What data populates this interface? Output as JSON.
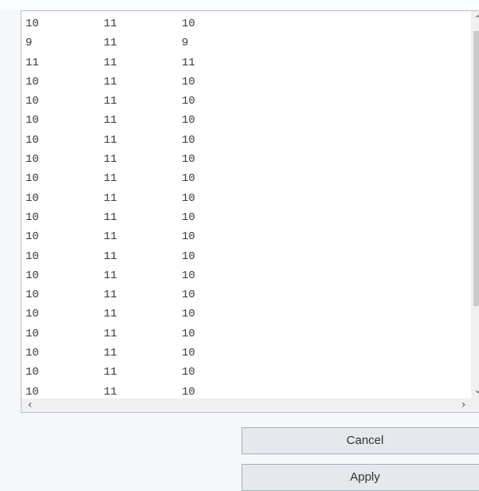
{
  "text_area": {
    "rows": [
      [
        "10",
        "11",
        "10"
      ],
      [
        "9",
        "11",
        "9"
      ],
      [
        "11",
        "11",
        "11"
      ],
      [
        "10",
        "11",
        "10"
      ],
      [
        "10",
        "11",
        "10"
      ],
      [
        "10",
        "11",
        "10"
      ],
      [
        "10",
        "11",
        "10"
      ],
      [
        "10",
        "11",
        "10"
      ],
      [
        "10",
        "11",
        "10"
      ],
      [
        "10",
        "11",
        "10"
      ],
      [
        "10",
        "11",
        "10"
      ],
      [
        "10",
        "11",
        "10"
      ],
      [
        "10",
        "11",
        "10"
      ],
      [
        "10",
        "11",
        "10"
      ],
      [
        "10",
        "11",
        "10"
      ],
      [
        "10",
        "11",
        "10"
      ],
      [
        "10",
        "11",
        "10"
      ],
      [
        "10",
        "11",
        "10"
      ],
      [
        "10",
        "11",
        "10"
      ],
      [
        "10",
        "11",
        "10"
      ]
    ]
  },
  "scrollbars": {
    "up_icon": "chevron-up-icon",
    "down_icon": "chevron-down-icon",
    "left_icon": "chevron-left-icon",
    "right_icon": "chevron-right-icon"
  },
  "buttons": {
    "cancel_label": "Cancel",
    "apply_label": "Apply"
  }
}
